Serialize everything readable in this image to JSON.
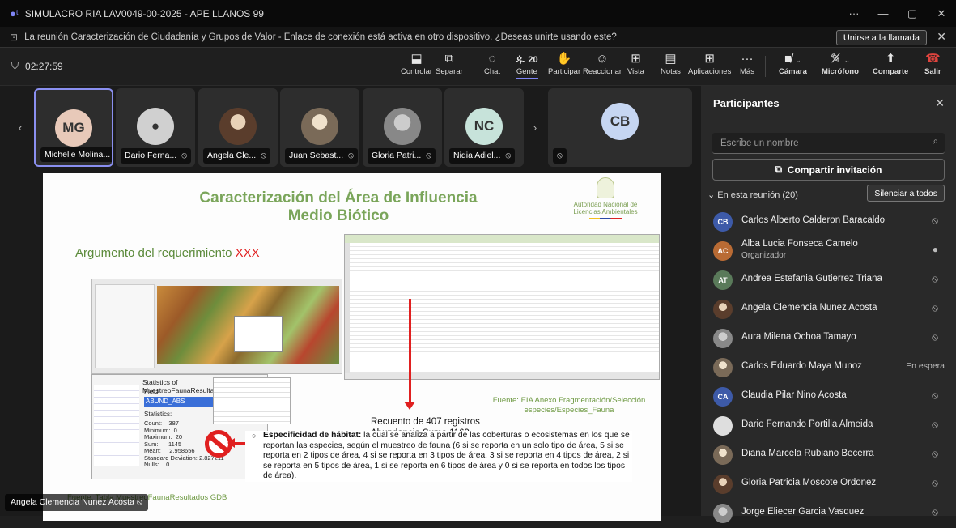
{
  "window": {
    "title": "SIMULACRO RIA LAV0049-00-2025 - APE LLANOS 99",
    "controls": [
      "···",
      "—",
      "▢",
      "✕"
    ]
  },
  "banner": {
    "text": "La reunión Caracterización de Ciudadanía y Grupos de Valor - Enlace de conexión está activa en otro dispositivo. ¿Deseas unirte usando este?",
    "join_label": "Unirse a la llamada"
  },
  "toolbar": {
    "timer": "02:27:59",
    "people_count": "20",
    "buttons": [
      {
        "label": "Controlar",
        "icon": "control-icon"
      },
      {
        "label": "Separar",
        "icon": "popout-icon"
      },
      {
        "label": "Chat",
        "icon": "chat-icon"
      },
      {
        "label": "Gente",
        "icon": "people-icon"
      },
      {
        "label": "Participar",
        "icon": "raise-hand-icon"
      },
      {
        "label": "Reaccionar",
        "icon": "react-icon"
      },
      {
        "label": "Vista",
        "icon": "view-icon"
      },
      {
        "label": "Notas",
        "icon": "notes-icon"
      },
      {
        "label": "Aplicaciones",
        "icon": "apps-icon"
      },
      {
        "label": "Más",
        "icon": "more-icon"
      },
      {
        "label": "Cámara",
        "icon": "camera-off-icon"
      },
      {
        "label": "Micrófono",
        "icon": "mic-off-icon"
      },
      {
        "label": "Comparte",
        "icon": "share-icon"
      },
      {
        "label": "Salir",
        "icon": "leave-icon"
      }
    ]
  },
  "gallery": {
    "tiles": [
      {
        "initials": "MG",
        "name": "Michelle Molina...",
        "color": "#e8c9b9"
      },
      {
        "initials": "",
        "name": "Dario Ferna...",
        "color": "#d0d0d0"
      },
      {
        "initials": "",
        "name": "Angela Cle...",
        "color": "#a38a72"
      },
      {
        "initials": "",
        "name": "Juan Sebast...",
        "color": "#c9b7a0"
      },
      {
        "initials": "",
        "name": "Gloria Patri...",
        "color": "#b8a892"
      },
      {
        "initials": "NC",
        "name": "Nidia Adiel...",
        "color": "#c7e3da"
      },
      {
        "initials": "CB",
        "name": "",
        "color": "#c6d6f2"
      }
    ]
  },
  "slide": {
    "title_line1": "Caracterización del Área de Influencia",
    "title_line2": "Medio Biótico",
    "logo_text": "Autoridad Nacional de Licencias Ambientales",
    "argument": "Argumento del requerimiento",
    "argument_red": "XXX",
    "stats_title": "Statistics of MuestreoFaunaResultadosTB",
    "field_label": "Field",
    "field_value": "ABUND_ABS",
    "statistics_label": "Statistics:",
    "stats_values": "Count:    387\nMinimum:  0\nMaximum:  20\nSum:      1145\nMean:     2.958656\nStandard Deviation: 2.827211\nNulls:    0",
    "source1": "Fuente: Tabla MuestreoFaunaResultados  GDB",
    "source2": "Fuente: EIA Anexo Fragmentación/Selección especies/Especies_Fauna",
    "recuento_line1": "Recuento de 407 registros",
    "recuento_line2": "Abundancia Suma 1169",
    "spec_bold": "Especificidad de hábitat:",
    "spec_text": " la cual se analiza a partir de las coberturas o ecosistemas en los que se reportan las especies, según el muestreo de fauna (6 si se reporta en un solo tipo de área, 5 si se reporta en 2 tipos de área, 4 si se reporta en 3 tipos de área, 3 si se reporta en 4 tipos de área, 2 si se reporta en 5 tipos de área, 1 si se reporta en 6 tipos de área y 0 si se reporta en todos los tipos de área)."
  },
  "presenter": "Angela Clemencia Nunez Acosta",
  "panel": {
    "title": "Participantes",
    "search_placeholder": "Escribe un nombre",
    "invite_label": "Compartir invitación",
    "section_label": "En esta reunión (20)",
    "silence_label": "Silenciar a todos",
    "participants": [
      {
        "initials": "CB",
        "name": "Carlos Alberto Calderon Baracaldo",
        "role": "",
        "status": "mic-off",
        "color": "#3d5aa8"
      },
      {
        "initials": "AC",
        "name": "Alba Lucia Fonseca Camelo",
        "role": "Organizador",
        "status": "mic-on",
        "color": "#b96b34"
      },
      {
        "initials": "AT",
        "name": "Andrea Estefania Gutierrez Triana",
        "role": "",
        "status": "mic-off",
        "color": "#5a7a5a"
      },
      {
        "initials": "",
        "name": "Angela Clemencia Nunez Acosta",
        "role": "",
        "status": "mic-off",
        "color": "photo"
      },
      {
        "initials": "",
        "name": "Aura Milena Ochoa Tamayo",
        "role": "",
        "status": "mic-off",
        "color": "photo3"
      },
      {
        "initials": "",
        "name": "Carlos Eduardo Maya Munoz",
        "role": "",
        "status": "En espera",
        "color": "photo2"
      },
      {
        "initials": "CA",
        "name": "Claudia Pilar Nino Acosta",
        "role": "",
        "status": "mic-off",
        "color": "#3d5aa8"
      },
      {
        "initials": "",
        "name": "Dario Fernando Portilla Almeida",
        "role": "",
        "status": "mic-off",
        "color": "blank"
      },
      {
        "initials": "",
        "name": "Diana Marcela Rubiano Becerra",
        "role": "",
        "status": "mic-off",
        "color": "photo2"
      },
      {
        "initials": "",
        "name": "Gloria Patricia Moscote Ordonez",
        "role": "",
        "status": "mic-off",
        "color": "photo"
      },
      {
        "initials": "",
        "name": "Jorge Eliecer Garcia Vasquez",
        "role": "",
        "status": "mic-off",
        "color": "photo3"
      }
    ]
  }
}
